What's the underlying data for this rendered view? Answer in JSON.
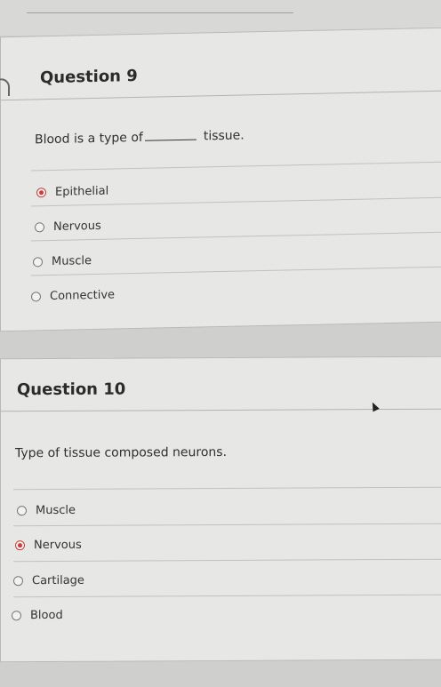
{
  "questions": [
    {
      "title": "Question 9",
      "prompt_before": "Blood is a type of",
      "prompt_after": "tissue.",
      "options": [
        {
          "label": "Epithelial",
          "selected": true
        },
        {
          "label": "Nervous",
          "selected": false
        },
        {
          "label": "Muscle",
          "selected": false
        },
        {
          "label": "Connective",
          "selected": false
        }
      ]
    },
    {
      "title": "Question 10",
      "prompt": "Type of tissue composed neurons.",
      "options": [
        {
          "label": "Muscle",
          "selected": false
        },
        {
          "label": "Nervous",
          "selected": true
        },
        {
          "label": "Cartilage",
          "selected": false
        },
        {
          "label": "Blood",
          "selected": false
        }
      ]
    }
  ],
  "colors": {
    "selected_radio": "#d23b3b",
    "card_bg": "#e7e8e5",
    "page_bg": "#cfd0cd"
  }
}
